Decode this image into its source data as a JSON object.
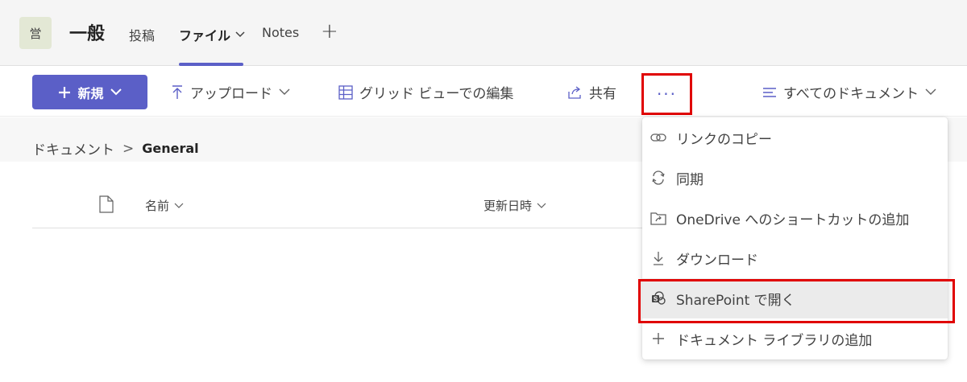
{
  "header": {
    "avatar_text": "営",
    "channel_title": "一般",
    "tabs": [
      {
        "label": "投稿"
      },
      {
        "label": "ファイル"
      },
      {
        "label": "Notes"
      }
    ],
    "add_tab_symbol": "+"
  },
  "toolbar": {
    "new_label": "新規",
    "upload_label": "アップロード",
    "grid_label": "グリッド ビューでの編集",
    "share_label": "共有",
    "more_label": "···",
    "view_label": "すべてのドキュメント"
  },
  "breadcrumb": {
    "root": "ドキュメント",
    "separator": ">",
    "current": "General"
  },
  "columns": {
    "name": "名前",
    "modified": "更新日時"
  },
  "menu": {
    "items": [
      {
        "label": "リンクのコピー",
        "icon": "link-icon"
      },
      {
        "label": "同期",
        "icon": "sync-icon"
      },
      {
        "label": "OneDrive へのショートカットの追加",
        "icon": "shortcut-icon"
      },
      {
        "label": "ダウンロード",
        "icon": "download-icon"
      },
      {
        "label": "SharePoint で開く",
        "icon": "sharepoint-icon"
      },
      {
        "label": "ドキュメント ライブラリの追加",
        "icon": "plus-icon"
      }
    ]
  },
  "colors": {
    "accent": "#5b5fc7",
    "highlight": "#e00000"
  }
}
